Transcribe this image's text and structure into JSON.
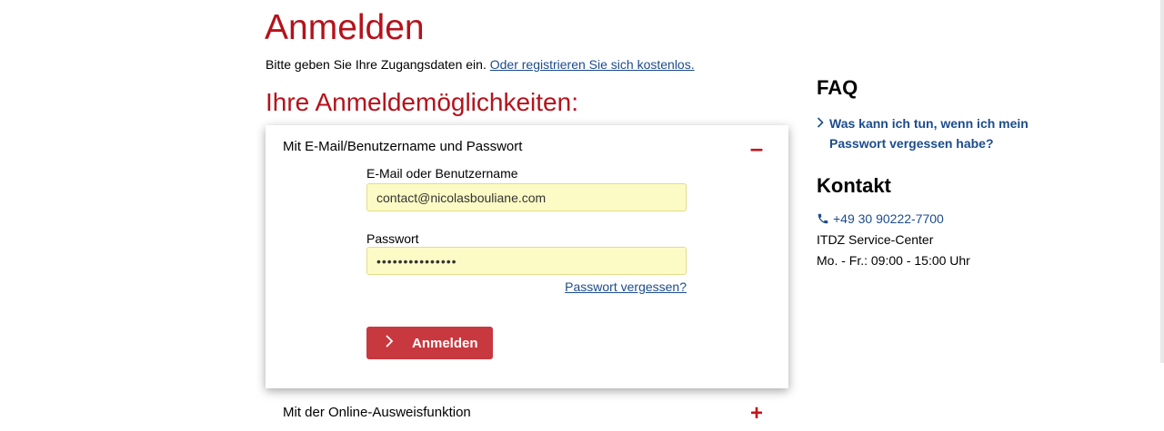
{
  "heading": "Anmelden",
  "intro": {
    "text": "Bitte geben Sie Ihre Zugangsdaten ein.",
    "register_link": "Oder registrieren Sie sich kostenlos."
  },
  "options_heading": "Ihre Anmeldemöglichkeiten:",
  "login_card": {
    "title": "Mit E-Mail/Benutzername und Passwort",
    "toggle": "–",
    "username_label": "E-Mail oder Benutzername",
    "username_value": "contact@nicolasbouliane.com",
    "password_label": "Passwort",
    "password_value": "•••••••••••••••",
    "forgot_link": "Passwort vergessen?",
    "submit_label": "Anmelden",
    "submit_icon": "chevron-right-icon"
  },
  "eid_option": {
    "title": "Mit der Online-Ausweisfunktion",
    "toggle": "+"
  },
  "faq": {
    "heading": "FAQ",
    "question": "Was kann ich tun, wenn ich mein Passwort vergessen habe?"
  },
  "contact": {
    "heading": "Kontakt",
    "phone": "+49 30 90222-7700",
    "phone_icon": "phone-icon",
    "service": "ITDZ Service-Center",
    "hours": "Mo. - Fr.: 09:00 - 15:00 Uhr"
  },
  "colors": {
    "brand_red": "#b5121b",
    "button_red": "#c8383f",
    "link_blue": "#1c4c8c",
    "input_fill": "#fdfbc5"
  }
}
